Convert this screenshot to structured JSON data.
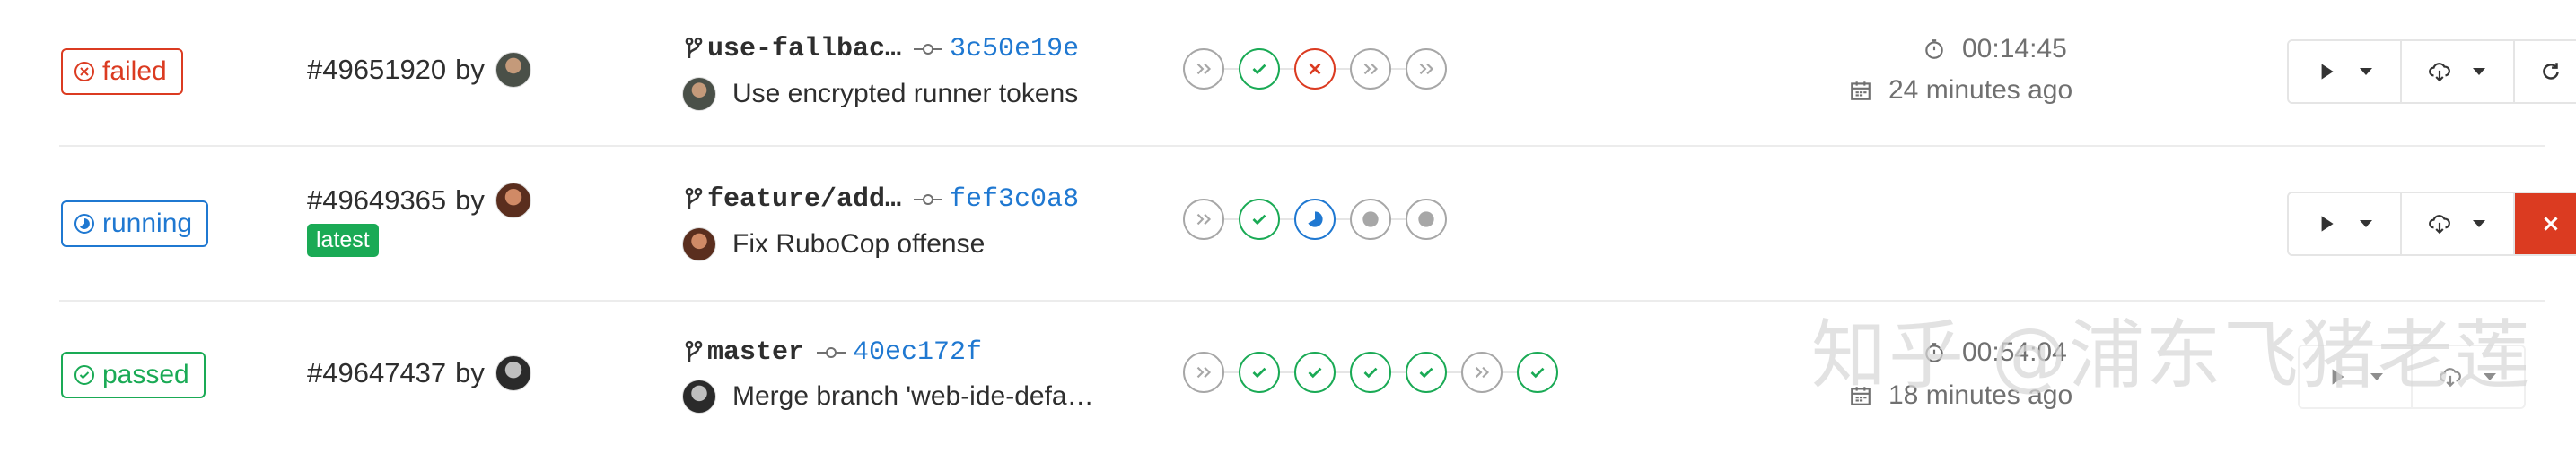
{
  "pipelines": [
    {
      "status": "failed",
      "id_text": "#49651920",
      "by": "by",
      "branch": "use-fallbac…",
      "sha": "3c50e19e",
      "message": "Use encrypted runner tokens",
      "duration": "00:14:45",
      "finished": "24 minutes ago",
      "stages": [
        "skipped",
        "success",
        "failed",
        "skipped",
        "skipped"
      ],
      "actions": [
        "play",
        "artifacts",
        "retry"
      ]
    },
    {
      "status": "running",
      "id_text": "#49649365",
      "by": "by",
      "tag": "latest",
      "branch": "feature/add…",
      "sha": "fef3c0a8",
      "message": "Fix RuboCop offense",
      "stages": [
        "skipped",
        "success",
        "running",
        "created",
        "created"
      ],
      "actions": [
        "play",
        "artifacts",
        "cancel"
      ]
    },
    {
      "status": "passed",
      "id_text": "#49647437",
      "by": "by",
      "branch": "master",
      "sha": "40ec172f",
      "message": "Merge branch 'web-ide-defa…",
      "duration": "00:54:04",
      "finished": "18 minutes ago",
      "stages": [
        "skipped",
        "success",
        "success",
        "success",
        "success",
        "skipped",
        "success"
      ],
      "actions": [
        "play",
        "artifacts"
      ]
    }
  ],
  "watermark": "知乎 @浦东飞猪老莲",
  "colors": {
    "failed": "#db3b21",
    "running": "#1f78d1",
    "passed": "#1aaa55",
    "skipped": "#a7a7a7",
    "link": "#1f78d1"
  },
  "icons": {
    "status_failed": "circle-x-icon",
    "status_running": "circle-half-icon",
    "status_passed": "circle-check-icon",
    "branch": "branch-icon",
    "commit": "commit-icon",
    "duration": "timer-icon",
    "finished": "calendar-icon",
    "play": "play-icon",
    "artifacts": "download-cloud-icon",
    "retry": "retry-icon",
    "cancel": "close-icon"
  }
}
